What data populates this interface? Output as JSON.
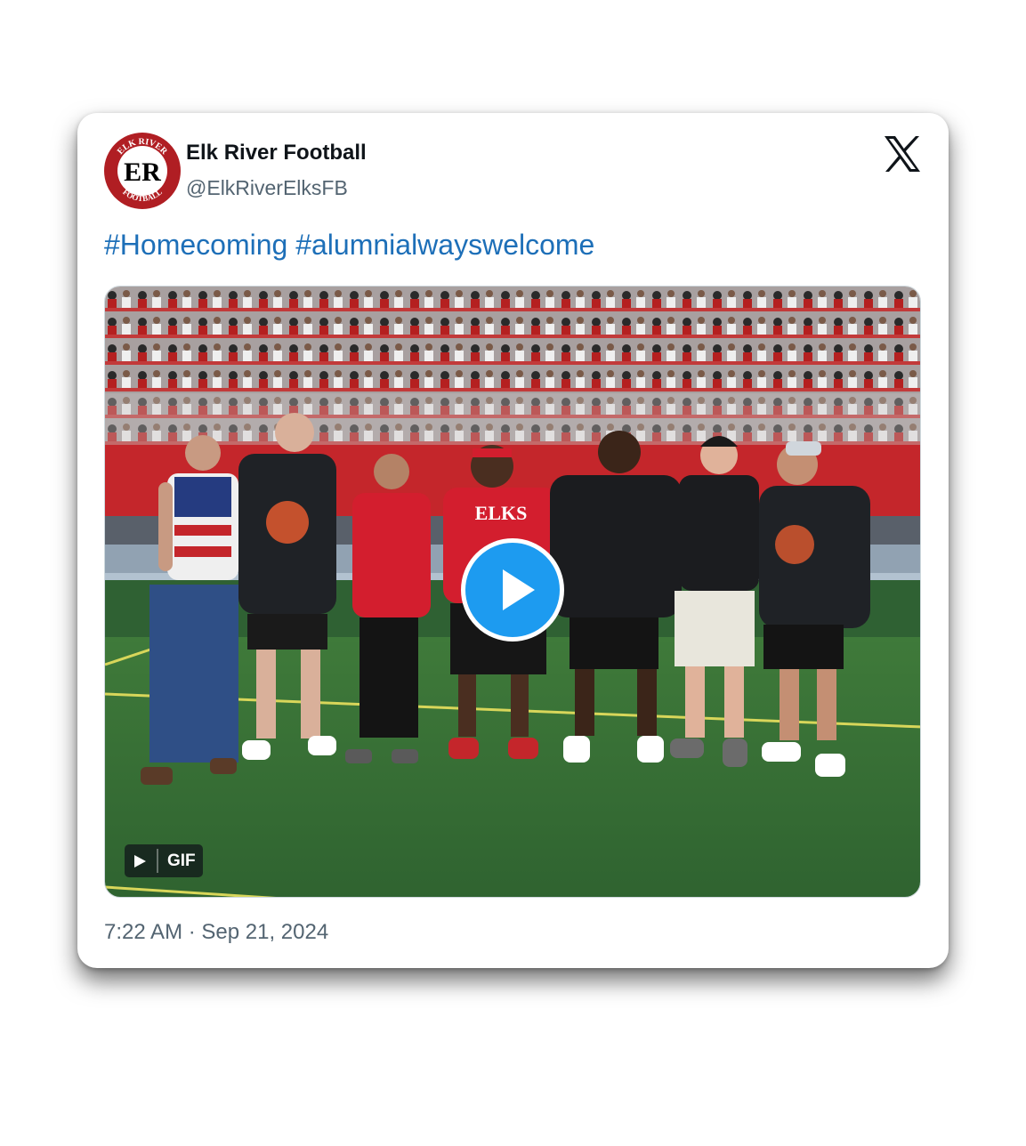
{
  "account": {
    "name": "Elk River Football",
    "handle": "@ElkRiverElksFB",
    "avatar_icon": "elk-river-football-logo",
    "avatar_text": {
      "top": "ELK RIVER",
      "monogram": "ER",
      "bottom": "FOOTBALL"
    }
  },
  "brand": {
    "icon": "x-logo-icon"
  },
  "tweet": {
    "hashtags": [
      "#Homecoming",
      "#alumnialwayswelcome"
    ]
  },
  "media": {
    "type": "gif",
    "badge_label": "GIF",
    "play_icon": "play-icon",
    "shirt_text": "ELKS"
  },
  "timestamp": "7:22 AM · Sep 21, 2024",
  "colors": {
    "link": "#1d6fb8",
    "play_button": "#1d9bf0",
    "brand_red": "#b01e23"
  }
}
